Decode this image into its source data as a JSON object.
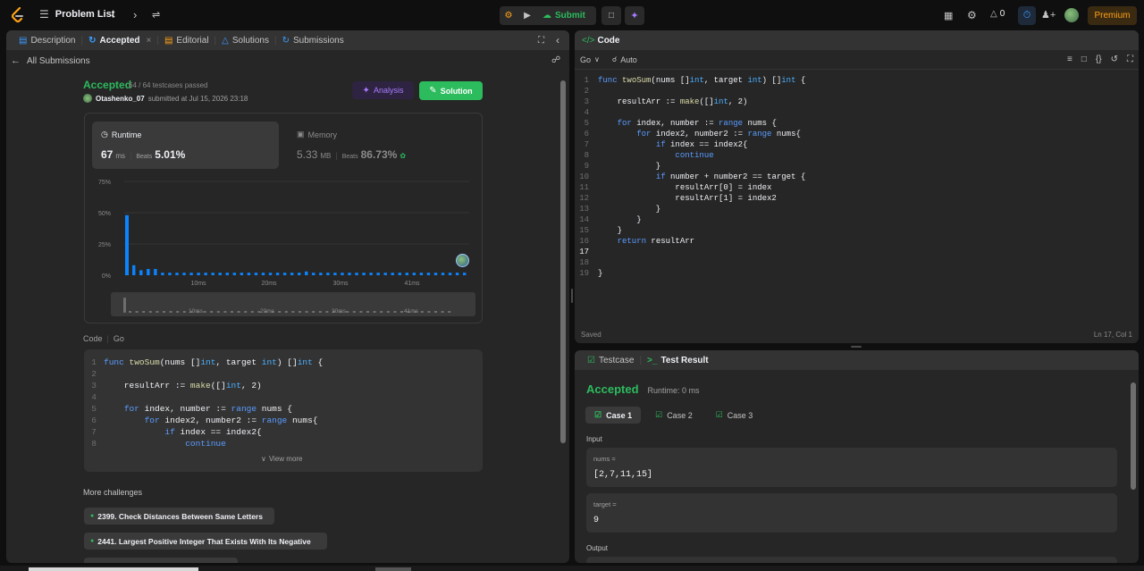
{
  "nav": {
    "title": "Problem List",
    "submit_label": "Submit",
    "streak_count": "0",
    "premium_label": "Premium"
  },
  "left": {
    "tabs": [
      {
        "label": "Description"
      },
      {
        "label": "Accepted"
      },
      {
        "label": "Editorial"
      },
      {
        "label": "Solutions"
      },
      {
        "label": "Submissions"
      }
    ],
    "back_label": "All Submissions",
    "status": "Accepted",
    "testcases": "64 / 64 testcases passed",
    "user": "Otashenko_07",
    "submitted_text": "submitted at Jul 15, 2026 23:18",
    "analysis_label": "Analysis",
    "solution_label": "Solution",
    "runtime": {
      "label": "Runtime",
      "value": "67",
      "unit": "ms",
      "beats_label": "Beats",
      "beats": "5.01%"
    },
    "memory": {
      "label": "Memory",
      "value": "5.33",
      "unit": "MB",
      "beats_label": "Beats",
      "beats": "86.73%"
    },
    "chart_y_labels": [
      "75%",
      "50%",
      "25%",
      "0%"
    ],
    "chart_x_labels": [
      "10ms",
      "20ms",
      "30ms",
      "41ms"
    ],
    "code_header": {
      "label": "Code",
      "lang": "Go"
    },
    "view_more": "View more",
    "more_challenges_title": "More challenges",
    "challenges": [
      {
        "label": "2399. Check Distances Between Same Letters"
      },
      {
        "label": "2441. Largest Positive Integer That Exists With Its Negative"
      }
    ],
    "code_lines": [
      "func twoSum(nums []int, target int) []int {",
      "",
      "    resultArr := make([]int, 2)",
      "",
      "    for index, number := range nums {",
      "        for index2, number2 := range nums{",
      "            if index == index2{",
      "                continue"
    ]
  },
  "chart_data": {
    "type": "bar",
    "y_ticks": [
      "75%",
      "50%",
      "25%",
      "0%"
    ],
    "x_ticks": [
      "10ms",
      "20ms",
      "30ms",
      "41ms"
    ],
    "ylim": [
      0,
      75
    ],
    "values": [
      48,
      8,
      4,
      5,
      5,
      2,
      2,
      2,
      2,
      2,
      2,
      2,
      2,
      2,
      2,
      2,
      2,
      2,
      2,
      2,
      2,
      2,
      2,
      2,
      2,
      3,
      2,
      2,
      2,
      2,
      2,
      2,
      2,
      2,
      2,
      2,
      2,
      2,
      2,
      2,
      2,
      2,
      2,
      2,
      2,
      2,
      2,
      2
    ],
    "highlight_index": 0,
    "colors": {
      "bar": "#0a84ff",
      "grid": "#3a3a3a"
    }
  },
  "editor": {
    "title": "Code",
    "lang": "Go",
    "mode": "Auto",
    "status_left": "Saved",
    "status_right": "Ln 17, Col 1",
    "lines": [
      "func twoSum(nums []int, target int) []int {",
      "",
      "    resultArr := make([]int, 2)",
      "",
      "    for index, number := range nums {",
      "        for index2, number2 := range nums{",
      "            if index == index2{",
      "                continue",
      "            }",
      "            if number + number2 == target {",
      "                resultArr[0] = index",
      "                resultArr[1] = index2",
      "            }",
      "        }",
      "    }",
      "    return resultArr",
      "",
      "",
      "}"
    ]
  },
  "testpanel": {
    "tab_testcase": "Testcase",
    "tab_result": "Test Result",
    "status": "Accepted",
    "runtime": "Runtime: 0 ms",
    "cases": [
      {
        "label": "Case 1"
      },
      {
        "label": "Case 2"
      },
      {
        "label": "Case 3"
      }
    ],
    "input_label": "Input",
    "nums_label": "nums =",
    "nums_value": "[2,7,11,15]",
    "target_label": "target =",
    "target_value": "9",
    "output_label": "Output"
  }
}
